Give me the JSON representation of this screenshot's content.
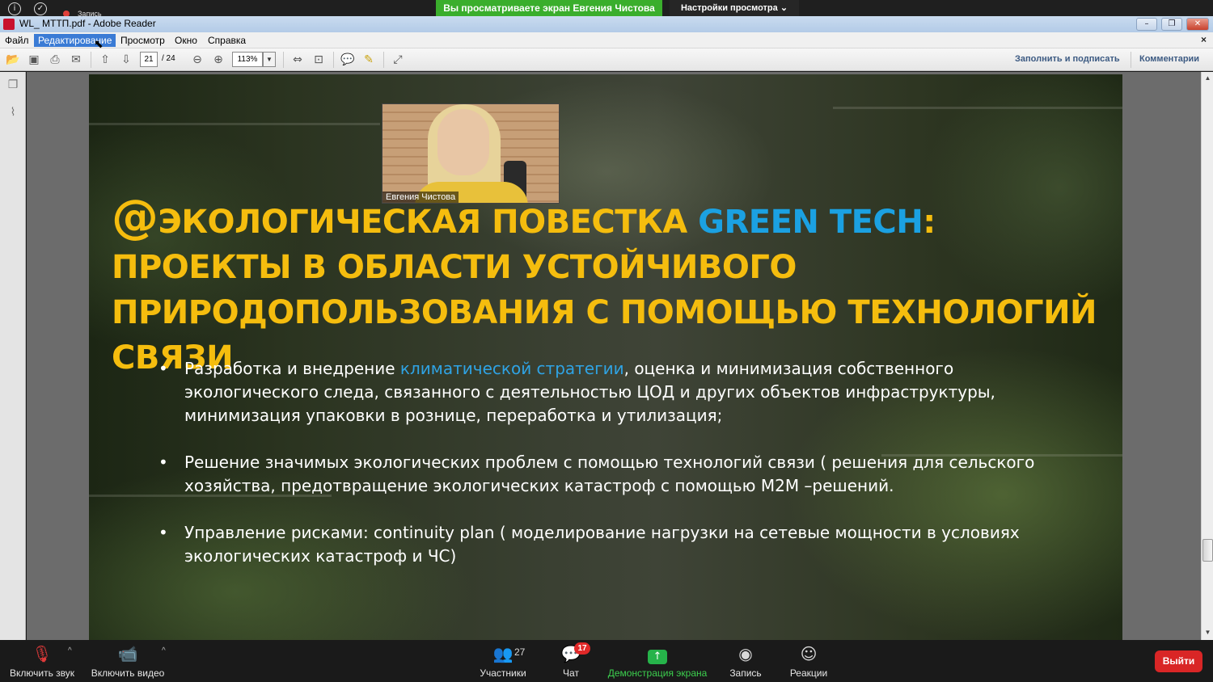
{
  "zoom_top": {
    "recording_label": "Запись",
    "share_banner": "Вы просматриваете экран Евгения Чистова",
    "view_settings": "Настройки просмотра ⌄"
  },
  "window": {
    "title": "WL_ МТТП.pdf - Adobe Reader",
    "minimize": "–",
    "restore": "❐",
    "close": "✕"
  },
  "menu": {
    "items": [
      "Файл",
      "Редактирование",
      "Просмотр",
      "Окно",
      "Справка"
    ],
    "active": "Редактирование",
    "close": "×"
  },
  "toolbar": {
    "page_current": "21",
    "page_total": "/ 24",
    "zoom": "113%",
    "fill_sign": "Заполнить и подписать",
    "comments": "Комментарии"
  },
  "video": {
    "participant_name": "Евгения Чистова"
  },
  "slide": {
    "title_at": "@",
    "title_part1": "ЭКОЛОГИЧЕСКАЯ ПОВЕСТКА ",
    "title_green": "GREEN TECH",
    "title_part2": ": ПРОЕКТЫ В ОБЛАСТИ УСТОЙЧИВОГО ПРИРОДОПОЛЬЗОВАНИЯ С ПОМОЩЬЮ ТЕХНОЛОГИЙ СВЯЗИ",
    "bullet1_pre": "Разработка и внедрение ",
    "bullet1_link": "климатической стратегии",
    "bullet1_post": ", оценка и минимизация собственного экологического следа, связанного с деятельностью ЦОД и других объектов инфраструктуры, минимизация упаковки в рознице, переработка и утилизация;",
    "bullet2": "Решение значимых экологических проблем с помощью технологий связи ( решения для сельского хозяйства, предотвращение экологических катастроф с помощью М2М –решений.",
    "bullet3": "Управление рисками: continuity plan ( моделирование нагрузки на сетевые мощности в условиях экологических катастроф и ЧС)"
  },
  "zoom_bottom": {
    "mute": "Включить звук",
    "video": "Включить видео",
    "participants": "Участники",
    "participants_count": "27",
    "chat": "Чат",
    "chat_badge": "17",
    "share": "Демонстрация экрана",
    "record": "Запись",
    "reactions": "Реакции",
    "leave": "Выйти"
  },
  "colors": {
    "title_yellow": "#f5bd0e",
    "title_blue": "#1ba1e2",
    "share_green": "#3aae2c",
    "leave_red": "#d92626"
  }
}
